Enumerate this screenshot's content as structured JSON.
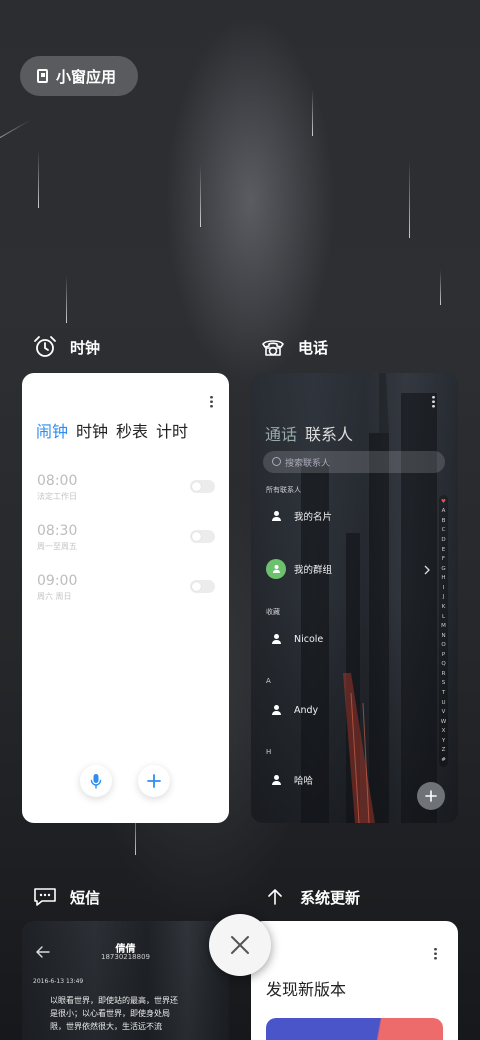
{
  "small_window_button": {
    "label": "小窗应用"
  },
  "apps": {
    "clock": {
      "title": "时钟",
      "tabs": [
        "闹钟",
        "时钟",
        "秒表",
        "计时"
      ],
      "alarms": [
        {
          "time": "08:00",
          "repeat": "法定工作日"
        },
        {
          "time": "08:30",
          "repeat": "周一至周五"
        },
        {
          "time": "09:00",
          "repeat": "周六 周日"
        }
      ]
    },
    "phone": {
      "title": "电话",
      "tabs": [
        "通话",
        "联系人"
      ],
      "search_placeholder": "搜索联系人",
      "all_contacts_label": "所有联系人",
      "my_card": "我的名片",
      "my_groups": "我的群组",
      "favorites_label": "收藏",
      "favorite_contact": "Nicole",
      "section_a": "A",
      "contact_a": "Andy",
      "section_h": "H",
      "contact_h": "哈哈",
      "index_letters": [
        "♥",
        "A",
        "B",
        "C",
        "D",
        "E",
        "F",
        "G",
        "H",
        "I",
        "J",
        "K",
        "L",
        "M",
        "N",
        "O",
        "P",
        "Q",
        "R",
        "S",
        "T",
        "U",
        "V",
        "W",
        "X",
        "Y",
        "Z",
        "#"
      ]
    },
    "sms": {
      "title": "短信",
      "contact_name": "倩倩",
      "phone_number": "18730218809",
      "timestamp": "2016-6-13 13:49",
      "message": "以眼看世界，即使站的最高，世界还是很小；以心看世界，即使身处局限，世界依然很大，生活远不流"
    },
    "update": {
      "title": "系统更新",
      "headline": "发现新版本"
    }
  },
  "colors": {
    "accent_blue": "#2e8df0",
    "group_green": "#6cc26c"
  }
}
